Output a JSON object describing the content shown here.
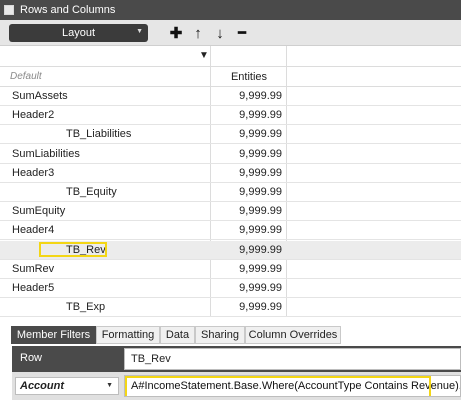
{
  "window": {
    "title": "Rows and Columns"
  },
  "toolbar": {
    "layout_label": "Layout",
    "buttons": [
      {
        "icon": "plus-icon",
        "glyph": "✚"
      },
      {
        "icon": "arrow-up-icon",
        "glyph": "↑"
      },
      {
        "icon": "arrow-down-icon",
        "glyph": "↓"
      },
      {
        "icon": "minus-icon",
        "glyph": "━"
      }
    ]
  },
  "grid": {
    "header_default": "Default",
    "column_header": "Entities",
    "rows": [
      {
        "name": "SumAssets",
        "indent": false,
        "value": "9,999.99",
        "selected": false
      },
      {
        "name": "Header2",
        "indent": false,
        "value": "9,999.99",
        "selected": false
      },
      {
        "name": "TB_Liabilities",
        "indent": true,
        "value": "9,999.99",
        "selected": false
      },
      {
        "name": "SumLiabilities",
        "indent": false,
        "value": "9,999.99",
        "selected": false
      },
      {
        "name": "Header3",
        "indent": false,
        "value": "9,999.99",
        "selected": false
      },
      {
        "name": "TB_Equity",
        "indent": true,
        "value": "9,999.99",
        "selected": false
      },
      {
        "name": "SumEquity",
        "indent": false,
        "value": "9,999.99",
        "selected": false
      },
      {
        "name": "Header4",
        "indent": false,
        "value": "9,999.99",
        "selected": false
      },
      {
        "name": "TB_Rev",
        "indent": true,
        "value": "9,999.99",
        "selected": true
      },
      {
        "name": "SumRev",
        "indent": false,
        "value": "9,999.99",
        "selected": false
      },
      {
        "name": "Header5",
        "indent": false,
        "value": "9,999.99",
        "selected": false
      },
      {
        "name": "TB_Exp",
        "indent": true,
        "value": "9,999.99",
        "selected": false
      }
    ]
  },
  "tabs": {
    "member_filters": "Member Filters",
    "formatting": "Formatting",
    "data": "Data",
    "sharing": "Sharing",
    "column_overrides": "Column Overrides"
  },
  "properties": {
    "row_label": "Row",
    "row_value": "TB_Rev",
    "dimension_selected": "Account",
    "member_filter": "A#IncomeStatement.Base.Where(AccountType Contains Revenue).Name("
  },
  "colors": {
    "highlight": "#f3d615",
    "dark_header": "#4a4a4a"
  }
}
